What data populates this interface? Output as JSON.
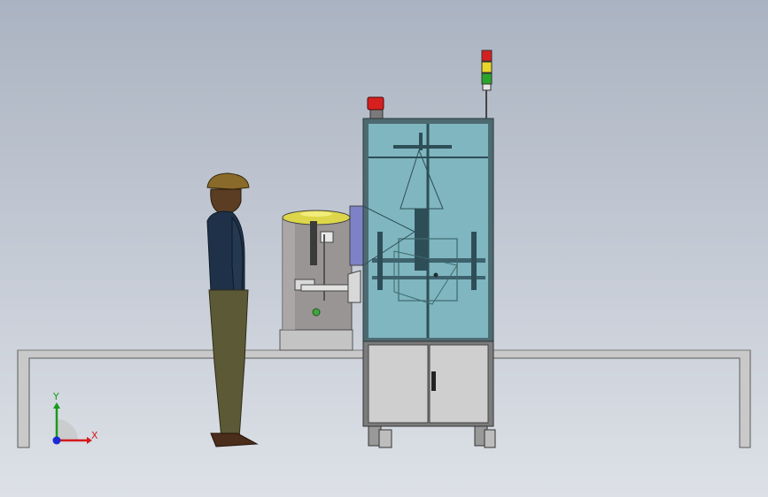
{
  "viewport": {
    "background_top": "#aab3c1",
    "background_bottom": "#dde1e7"
  },
  "triad": {
    "x_label": "X",
    "y_label": "Y",
    "x_color": "#d41a1a",
    "y_color": "#1a9a1a",
    "z_color": "#1a2ad4"
  },
  "model": {
    "parts": [
      "workbench-frame",
      "human-figure",
      "feeder-bowl",
      "glass-cabinet",
      "lower-cabinet",
      "signal-tower",
      "beacon-light"
    ],
    "glass_color": "#7fb6c0",
    "frame_color": "#2e4e57",
    "tower_colors": [
      "#d62020",
      "#e8d62a",
      "#2aa52a"
    ],
    "beacon_color": "#d62020"
  }
}
